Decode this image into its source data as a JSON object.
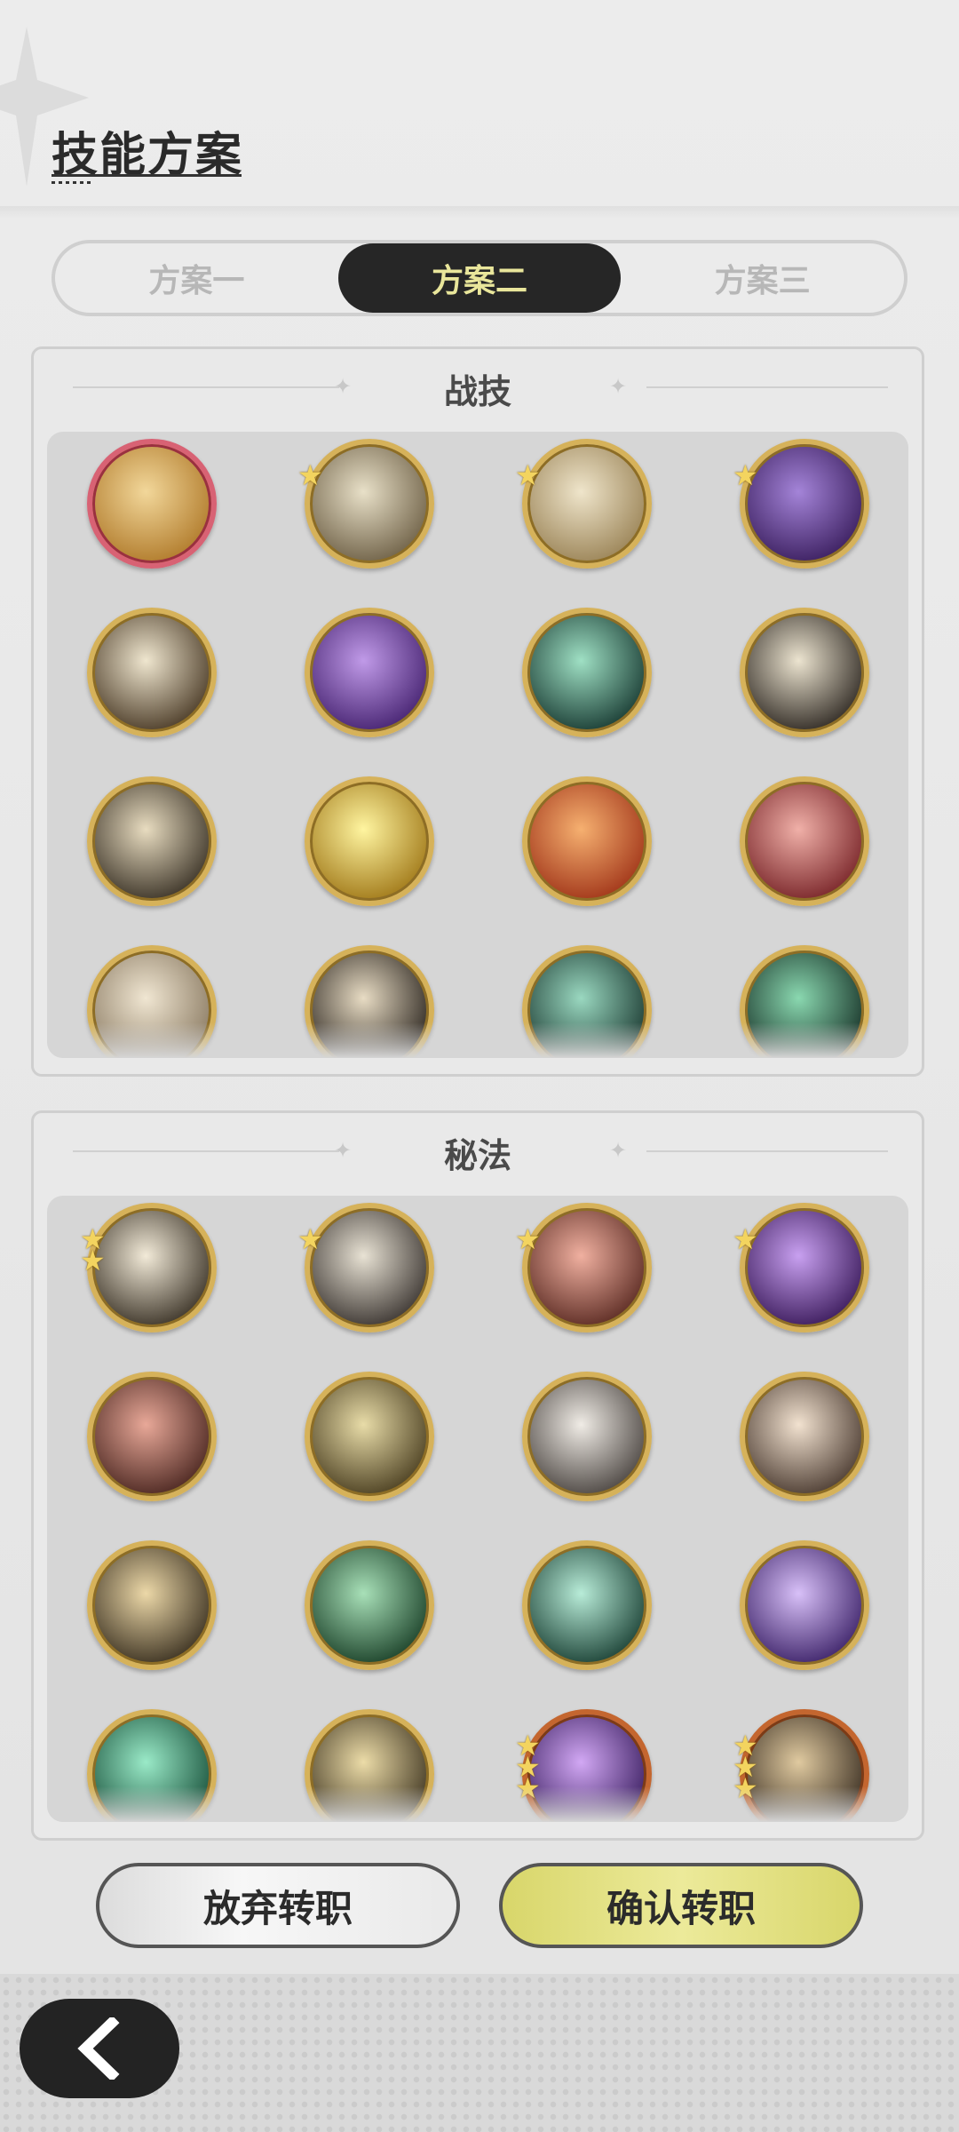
{
  "header": {
    "title": "技能方案"
  },
  "tabs": [
    {
      "label": "方案一",
      "active": false
    },
    {
      "label": "方案二",
      "active": true
    },
    {
      "label": "方案三",
      "active": false
    }
  ],
  "sections": [
    {
      "title": "战技",
      "skills": [
        {
          "icon": "swirl-strike-skill-icon",
          "stars": 0,
          "frame": "red",
          "colors": [
            "#f2d79a",
            "#b07a2a"
          ]
        },
        {
          "icon": "vortex-skill-icon",
          "stars": 1,
          "frame": "gold",
          "colors": [
            "#e8e0c8",
            "#6e6046"
          ]
        },
        {
          "icon": "whirlwind-skill-icon",
          "stars": 1,
          "frame": "gold",
          "colors": [
            "#efe5cb",
            "#9a8356"
          ]
        },
        {
          "icon": "shadow-claw-skill-icon",
          "stars": 1,
          "frame": "gold",
          "colors": [
            "#a484d8",
            "#3a1e5e"
          ]
        },
        {
          "icon": "piercing-arrow-skill-icon",
          "stars": 0,
          "frame": "gold",
          "colors": [
            "#efe6cf",
            "#4a3a26"
          ]
        },
        {
          "icon": "void-heart-skill-icon",
          "stars": 0,
          "frame": "gold",
          "colors": [
            "#c09ae8",
            "#452270"
          ]
        },
        {
          "icon": "crescent-slash-skill-icon",
          "stars": 0,
          "frame": "gold",
          "colors": [
            "#9fe0c4",
            "#183a32"
          ]
        },
        {
          "icon": "cross-burst-skill-icon",
          "stars": 0,
          "frame": "gold",
          "colors": [
            "#ece4d0",
            "#2e2822"
          ]
        },
        {
          "icon": "lightning-slash-skill-icon",
          "stars": 0,
          "frame": "gold",
          "colors": [
            "#e8dcc0",
            "#3a3226"
          ]
        },
        {
          "icon": "golden-shield-skill-icon",
          "stars": 0,
          "frame": "gold",
          "colors": [
            "#fff5a0",
            "#a07818"
          ]
        },
        {
          "icon": "flame-emblem-skill-icon",
          "stars": 0,
          "frame": "gold",
          "colors": [
            "#f6b070",
            "#a03418"
          ]
        },
        {
          "icon": "rage-warrior-skill-icon",
          "stars": 0,
          "frame": "gold",
          "colors": [
            "#f0b0a8",
            "#782428"
          ]
        },
        {
          "icon": "afterimage-dash-skill-icon",
          "stars": 0,
          "frame": "gold",
          "colors": [
            "#f0e6d2",
            "#8a7a62"
          ]
        },
        {
          "icon": "leap-strike-skill-icon",
          "stars": 0,
          "frame": "gold",
          "colors": [
            "#e8dcc4",
            "#2a241e"
          ]
        },
        {
          "icon": "spider-web-skill-icon",
          "stars": 0,
          "frame": "gold",
          "colors": [
            "#9ad8c0",
            "#1a3830"
          ]
        },
        {
          "icon": "sword-burst-skill-icon",
          "stars": 0,
          "frame": "gold",
          "colors": [
            "#8ad8b0",
            "#163026"
          ]
        }
      ]
    },
    {
      "title": "秘法",
      "skills": [
        {
          "icon": "all-seeing-eye-skill-icon",
          "stars": 2,
          "frame": "gold",
          "colors": [
            "#f2ead8",
            "#3a3226"
          ]
        },
        {
          "icon": "moon-leaf-skill-icon",
          "stars": 1,
          "frame": "gold",
          "colors": [
            "#e8e2d4",
            "#3a3430"
          ]
        },
        {
          "icon": "armor-guard-skill-icon",
          "stars": 1,
          "frame": "gold",
          "colors": [
            "#f0b0a0",
            "#5a2a22"
          ]
        },
        {
          "icon": "purple-flame-skill-icon",
          "stars": 1,
          "frame": "gold",
          "colors": [
            "#c8a0f0",
            "#3a1a5a"
          ]
        },
        {
          "icon": "blood-strike-skill-icon",
          "stars": 0,
          "frame": "gold",
          "colors": [
            "#e8a898",
            "#4a2620"
          ]
        },
        {
          "icon": "golden-guard-skill-icon",
          "stars": 0,
          "frame": "gold",
          "colors": [
            "#e8dca8",
            "#4a3e20"
          ]
        },
        {
          "icon": "sword-emblem-skill-icon",
          "stars": 0,
          "frame": "gold",
          "colors": [
            "#f0ece6",
            "#4a4440"
          ]
        },
        {
          "icon": "heart-shield-skill-icon",
          "stars": 0,
          "frame": "gold",
          "colors": [
            "#f2e2d0",
            "#4a3a30"
          ]
        },
        {
          "icon": "spiral-vortex-skill-icon",
          "stars": 0,
          "frame": "gold",
          "colors": [
            "#ecd8a8",
            "#3a3020"
          ]
        },
        {
          "icon": "heal-heart-skill-icon",
          "stars": 0,
          "frame": "gold",
          "colors": [
            "#a8e0b8",
            "#1a4028"
          ]
        },
        {
          "icon": "healing-circle-skill-icon",
          "stars": 0,
          "frame": "gold",
          "colors": [
            "#b8ecd8",
            "#1a4034"
          ]
        },
        {
          "icon": "shadow-figure-skill-icon",
          "stars": 0,
          "frame": "gold",
          "colors": [
            "#d8c0f8",
            "#3c2268"
          ]
        },
        {
          "icon": "jade-sword-skill-icon",
          "stars": 0,
          "frame": "gold",
          "colors": [
            "#9aeac8",
            "#18503a"
          ]
        },
        {
          "icon": "holy-aid-skill-icon",
          "stars": 0,
          "frame": "gold",
          "colors": [
            "#ecdca8",
            "#3e3420"
          ]
        },
        {
          "icon": "arcane-summon-skill-icon",
          "stars": 3,
          "frame": "orange",
          "colors": [
            "#d2a8f4",
            "#3a1e60"
          ]
        },
        {
          "icon": "beast-fang-skill-icon",
          "stars": 3,
          "frame": "orange",
          "colors": [
            "#e0caa0",
            "#3a2e22"
          ]
        }
      ]
    }
  ],
  "buttons": {
    "cancel": "放弃转职",
    "confirm": "确认转职"
  },
  "colors": {
    "active_tab_bg": "#262626",
    "active_tab_text": "#e9e69b",
    "confirm_bg": "#e3e17f"
  }
}
